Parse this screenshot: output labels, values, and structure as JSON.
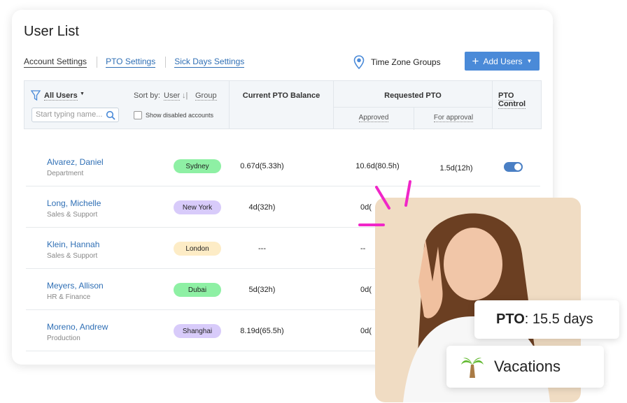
{
  "title": "User List",
  "tabs": [
    {
      "label": "Account Settings"
    },
    {
      "label": "PTO Settings"
    },
    {
      "label": "Sick Days Settings"
    }
  ],
  "time_zone_groups": "Time Zone Groups",
  "add_users": "Add Users",
  "header": {
    "all_users": "All Users",
    "search_placeholder": "Start typing name...",
    "sort_by": "Sort by:",
    "sort_user": "User",
    "sort_group": "Group",
    "show_disabled": "Show disabled accounts",
    "current_balance": "Current PTO Balance",
    "requested": "Requested PTO",
    "approved": "Approved",
    "for_approval": "For approval",
    "pto_control": "PTO Control"
  },
  "rows": [
    {
      "name": "Alvarez, Daniel",
      "dept": "Department",
      "location": "Sydney",
      "color": "#8ef0a4",
      "balance": "0.67d(5.33h)",
      "approved": "10.6d(80.5h)",
      "for_approval": "1.5d(12h)",
      "toggle": true
    },
    {
      "name": "Long, Michelle",
      "dept": "Sales & Support",
      "location": "New York",
      "color": "#d8cbfa",
      "balance": "4d(32h)",
      "approved": "0d("
    },
    {
      "name": "Klein, Hannah",
      "dept": "Sales & Support",
      "location": "London",
      "color": "#fdecc6",
      "balance": "---",
      "approved": "--"
    },
    {
      "name": "Meyers, Allison",
      "dept": "HR & Finance",
      "location": "Dubai",
      "color": "#8ef0a4",
      "balance": "5d(32h)",
      "approved": "0d("
    },
    {
      "name": "Moreno, Andrew",
      "dept": "Production",
      "location": "Shanghai",
      "color": "#d8cbfa",
      "balance": "8.19d(65.5h)",
      "approved": "0d("
    }
  ],
  "pto_card": {
    "label": "PTO",
    "value": ": 15.5 days"
  },
  "vacation_card": {
    "label": "Vacations",
    "icon": "palm-tree-icon"
  },
  "accent": "#4a8ad8"
}
